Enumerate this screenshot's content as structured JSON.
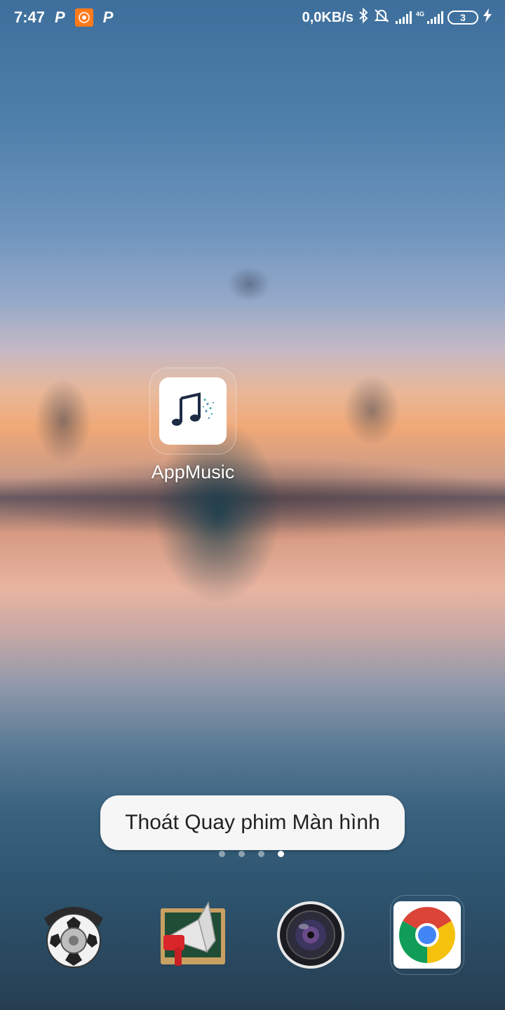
{
  "status_bar": {
    "time": "7:47",
    "notif_1": "P",
    "notif_3": "P",
    "net_speed": "0,0KB/s",
    "net_type": "4G",
    "battery": "3",
    "icons": [
      "parking-icon",
      "screen-recorder-icon",
      "parking-icon",
      "bluetooth-icon",
      "alarm-off-icon",
      "signal-icon",
      "signal-4g-icon",
      "battery-icon",
      "charging-icon"
    ]
  },
  "home": {
    "app": {
      "label": "AppMusic",
      "icon": "music-note-icon"
    }
  },
  "toast": {
    "text": "Thoát Quay phim Màn hình"
  },
  "pager": {
    "pages": 4,
    "active": 4
  },
  "dock": {
    "apps": [
      {
        "name": "phone",
        "icon": "rotary-phone-soccer-icon"
      },
      {
        "name": "notification",
        "icon": "megaphone-board-icon"
      },
      {
        "name": "camera",
        "icon": "camera-lens-icon"
      },
      {
        "name": "chrome",
        "icon": "chrome-icon"
      }
    ]
  },
  "colors": {
    "recorder_orange": "#ff7a1a",
    "toast_bg": "#f6f6f6",
    "chrome_red": "#db4437",
    "chrome_yellow": "#f4c20d",
    "chrome_green": "#0f9d58",
    "chrome_blue": "#4285f4"
  }
}
